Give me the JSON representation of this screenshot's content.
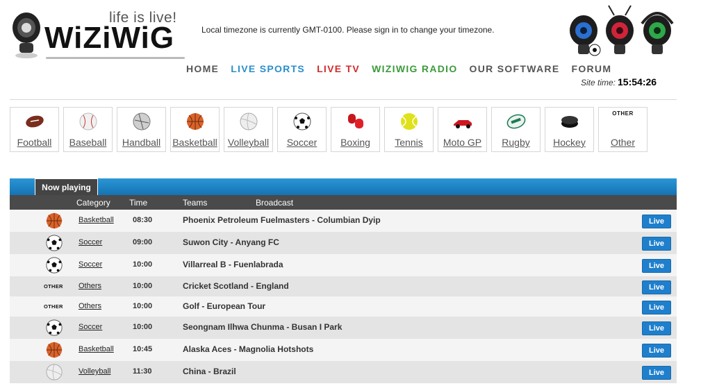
{
  "header": {
    "logo_text": "WiZiWiG",
    "tagline": "life is live!",
    "timezone_msg": "Local timezone is currently GMT-0100. Please sign in to change your timezone.",
    "site_time_label": "Site time:",
    "site_time": "15:54:26"
  },
  "nav": [
    {
      "label": "HOME",
      "color": "#555555"
    },
    {
      "label": "LIVE SPORTS",
      "color": "#2a8fc9"
    },
    {
      "label": "LIVE TV",
      "color": "#d22a2a"
    },
    {
      "label": "WIZIWIG RADIO",
      "color": "#3c9a3c"
    },
    {
      "label": "OUR SOFTWARE",
      "color": "#555555"
    },
    {
      "label": "FORUM",
      "color": "#555555"
    }
  ],
  "sports": [
    {
      "label": "Football",
      "icon": "american-football-icon"
    },
    {
      "label": "Baseball",
      "icon": "baseball-icon"
    },
    {
      "label": "Handball",
      "icon": "handball-icon"
    },
    {
      "label": "Basketball",
      "icon": "basketball-icon"
    },
    {
      "label": "Volleyball",
      "icon": "volleyball-icon"
    },
    {
      "label": "Soccer",
      "icon": "soccer-ball-icon"
    },
    {
      "label": "Boxing",
      "icon": "boxing-gloves-icon"
    },
    {
      "label": "Tennis",
      "icon": "tennis-ball-icon"
    },
    {
      "label": "Moto GP",
      "icon": "race-car-icon"
    },
    {
      "label": "Rugby",
      "icon": "rugby-ball-icon"
    },
    {
      "label": "Hockey",
      "icon": "hockey-puck-icon"
    },
    {
      "label": "Other",
      "icon": "other-icon",
      "icon_text": "OTHER"
    }
  ],
  "now_playing": {
    "tab_label": "Now playing",
    "columns": {
      "category": "Category",
      "time": "Time",
      "teams": "Teams",
      "broadcast": "Broadcast"
    },
    "live_label": "Live",
    "other_icon_text": "OTHER",
    "rows": [
      {
        "category": "Basketball",
        "icon": "basketball",
        "time": "08:30",
        "teams": "Phoenix Petroleum Fuelmasters - Columbian Dyip"
      },
      {
        "category": "Soccer",
        "icon": "soccer",
        "time": "09:00",
        "teams": "Suwon City - Anyang FC"
      },
      {
        "category": "Soccer",
        "icon": "soccer",
        "time": "10:00",
        "teams": "Villarreal B - Fuenlabrada"
      },
      {
        "category": "Others",
        "icon": "other",
        "time": "10:00",
        "teams": "Cricket Scotland - England"
      },
      {
        "category": "Others",
        "icon": "other",
        "time": "10:00",
        "teams": "Golf - European Tour"
      },
      {
        "category": "Soccer",
        "icon": "soccer",
        "time": "10:00",
        "teams": "Seongnam Ilhwa Chunma - Busan I Park"
      },
      {
        "category": "Basketball",
        "icon": "basketball",
        "time": "10:45",
        "teams": "Alaska Aces - Magnolia Hotshots"
      },
      {
        "category": "Volleyball",
        "icon": "volleyball",
        "time": "11:30",
        "teams": "China - Brazil"
      }
    ]
  }
}
